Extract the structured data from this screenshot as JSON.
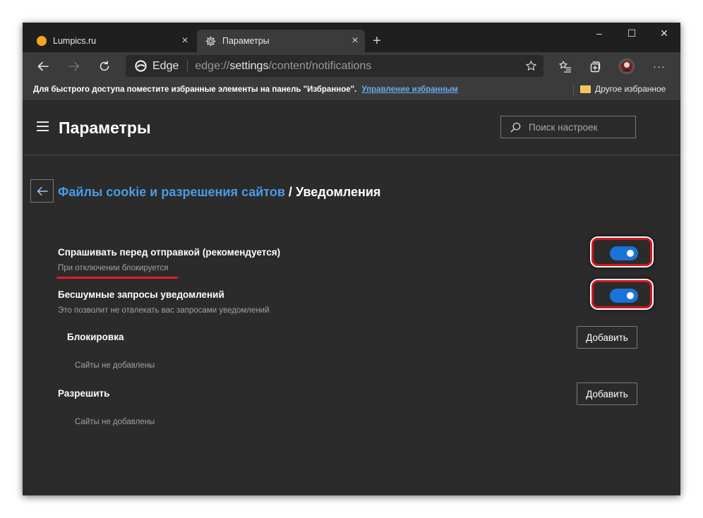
{
  "tabs": [
    {
      "title": "Lumpics.ru",
      "icon": "orange-circle-favicon",
      "close": "×"
    },
    {
      "title": "Параметры",
      "icon": "gear-icon",
      "close": "×"
    }
  ],
  "new_tab": "+",
  "window_controls": {
    "minimize": "–",
    "maximize": "☐",
    "close": "✕"
  },
  "toolbar": {
    "edge_label": "Edge",
    "url_prefix": "edge://",
    "url_host": "settings",
    "url_path": "/content/notifications",
    "more": "···"
  },
  "bookmarks_bar": {
    "message": "Для быстрого доступа поместите избранные элементы на панель \"Избранное\".",
    "manage_link": "Управление избранным",
    "other_favorites": "Другое избранное"
  },
  "header": {
    "title": "Параметры",
    "search_placeholder": "Поиск настроек"
  },
  "breadcrumb": {
    "parent": "Файлы cookie и разрешения сайтов",
    "separator": " / ",
    "current": "Уведомления"
  },
  "settings": [
    {
      "title": "Спрашивать перед отправкой (рекомендуется)",
      "description": "При отключении блокируется",
      "enabled": true
    },
    {
      "title": "Бесшумные запросы уведомлений",
      "description": "Это позволит не отвлекать вас запросами уведомлений",
      "enabled": true
    }
  ],
  "block_section": {
    "title": "Блокировка",
    "add_label": "Добавить",
    "empty_text": "Сайты не добавлены"
  },
  "allow_section": {
    "title": "Разрешить",
    "add_label": "Добавить",
    "empty_text": "Сайты не добавлены"
  },
  "colors": {
    "accent": "#1a73d8",
    "link": "#4c9be6",
    "highlight": "#d4161f",
    "background": "#2b2b2b"
  }
}
